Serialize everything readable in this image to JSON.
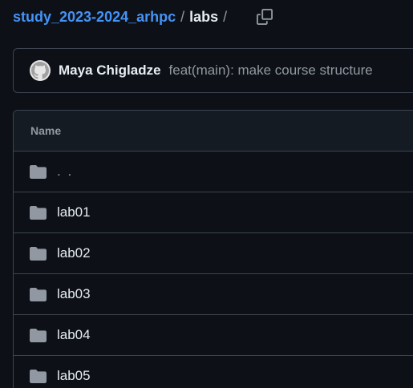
{
  "breadcrumb": {
    "repo": "study_2023-2024_arhpc",
    "separator": "/",
    "current": "labs",
    "trailing_separator": "/"
  },
  "icons": {
    "copy": "copy-icon",
    "folder": "folder-icon",
    "avatar": "github-avatar-icon"
  },
  "commit": {
    "author": "Maya Chigladze",
    "message": "feat(main): make course structure"
  },
  "table": {
    "header_name": "Name",
    "rows": [
      {
        "name": ". ."
      },
      {
        "name": "lab01"
      },
      {
        "name": "lab02"
      },
      {
        "name": "lab03"
      },
      {
        "name": "lab04"
      },
      {
        "name": "lab05"
      }
    ]
  },
  "colors": {
    "background": "#0d1117",
    "link": "#4493f8",
    "border": "#3d444d",
    "text": "#e6edf3",
    "muted": "#9198a1"
  }
}
